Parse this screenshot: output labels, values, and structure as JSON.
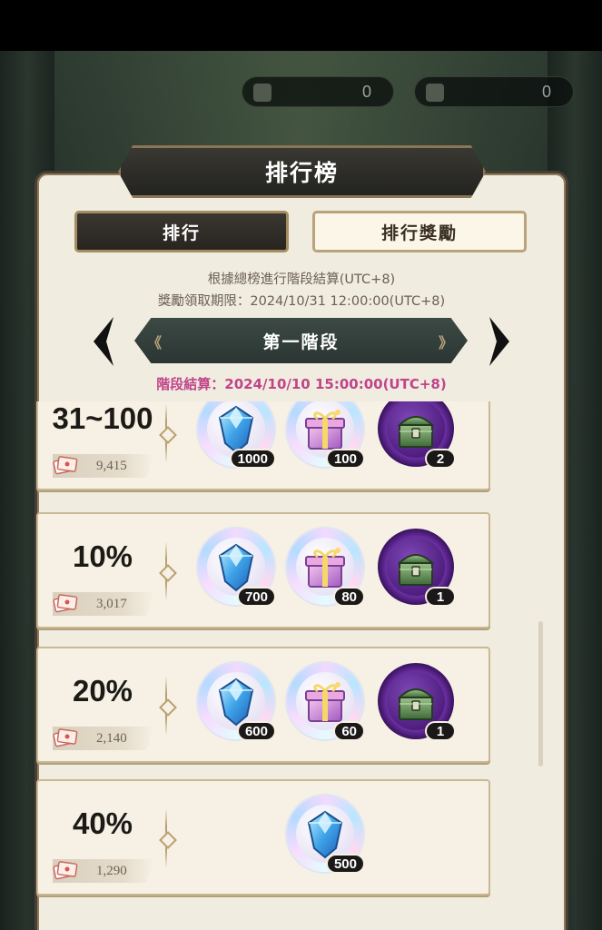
{
  "top_currency": [
    {
      "icon": "ticket-icon",
      "value": "0"
    },
    {
      "icon": "gem-icon",
      "value": "0"
    }
  ],
  "title": "排行榜",
  "tabs": {
    "ranking": "排行",
    "rewards": "排行獎勵",
    "active": "ranking"
  },
  "info": {
    "line1": "根據總榜進行階段結算(UTC+8)",
    "line2": "獎勵領取期限：2024/10/31 12:00:00(UTC+8)"
  },
  "stage": {
    "label": "第一階段",
    "settlement": "階段結算：2024/10/10 15:00:00(UTC+8)"
  },
  "tiers": [
    {
      "rank": "31~100",
      "score": "9,415",
      "rewards": [
        {
          "item": "diamond-icon",
          "qty": "1000"
        },
        {
          "item": "gift-box-icon",
          "qty": "100"
        },
        {
          "item": "treasure-chest-icon",
          "qty": "2"
        }
      ]
    },
    {
      "rank": "10%",
      "score": "3,017",
      "rewards": [
        {
          "item": "diamond-icon",
          "qty": "700"
        },
        {
          "item": "gift-box-icon",
          "qty": "80"
        },
        {
          "item": "treasure-chest-icon",
          "qty": "1"
        }
      ]
    },
    {
      "rank": "20%",
      "score": "2,140",
      "rewards": [
        {
          "item": "diamond-icon",
          "qty": "600"
        },
        {
          "item": "gift-box-icon",
          "qty": "60"
        },
        {
          "item": "treasure-chest-icon",
          "qty": "1"
        }
      ]
    },
    {
      "rank": "40%",
      "score": "1,290",
      "rewards": [
        {
          "item": "diamond-icon",
          "qty": "500"
        }
      ]
    }
  ],
  "colors": {
    "settlement_text": "#c0448a",
    "panel_bg": "#f1ece0",
    "dark_plate": "#2b3633"
  }
}
